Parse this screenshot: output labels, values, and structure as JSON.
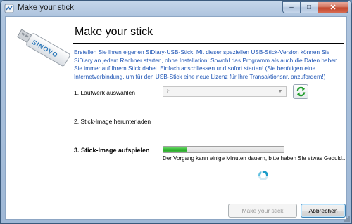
{
  "window": {
    "title": "Make your stick",
    "controls": {
      "minimize": "–",
      "maximize": "□",
      "close": "✕"
    }
  },
  "header": {
    "title": "Make your stick",
    "logo_text": "SINOVO"
  },
  "intro": "Erstellen Sie Ihren eigenen SiDiary-USB-Stick: Mit dieser speziellen USB-Stick-Version können Sie SiDiary an jedem Rechner starten, ohne Installation! Sowohl das Programm als auch die Daten haben Sie immer auf Ihrem Stick dabei. Einfach anschliessen und sofort starten! (Sie benötigen eine Internetverbindung, um für den USB-Stick eine neue Lizenz für Ihre Transaktionsnr. anzufordern!)",
  "steps": [
    {
      "label": "1. Laufwerk auswählen",
      "active": false
    },
    {
      "label": "2. Stick-Image herunterladen",
      "active": false
    },
    {
      "label": "3. Stick-Image aufspielen",
      "active": true
    }
  ],
  "drive_select": {
    "value": "i:",
    "icon": "chevron-down-icon"
  },
  "refresh_icon": "refresh-icon",
  "progress": {
    "fraction": 0.2,
    "text": "Der Vorgang kann einige Minuten dauern, bitte haben Sie etwas Geduld..."
  },
  "buttons": {
    "make": "Make your stick",
    "cancel": "Abbrechen"
  },
  "colors": {
    "intro_text": "#1f55b5",
    "progress_fill": "#2fb52f",
    "title_bar": "#aec4de"
  }
}
